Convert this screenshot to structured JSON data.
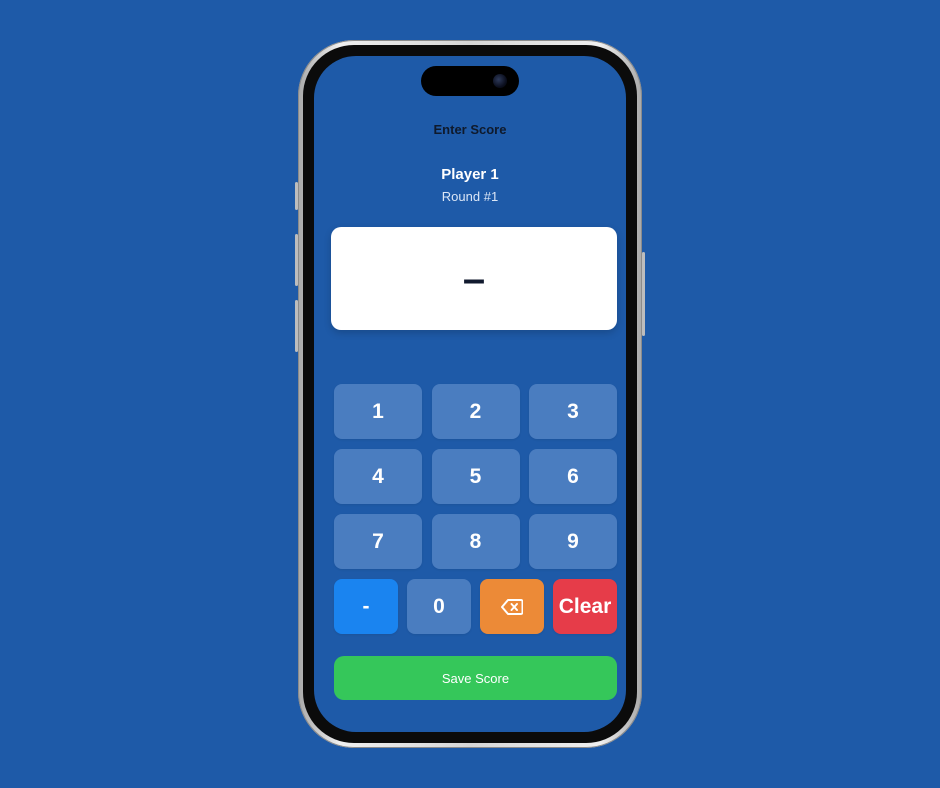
{
  "header": {
    "title": "Enter Score"
  },
  "player": {
    "name": "Player 1",
    "round": "Round #1"
  },
  "display": {
    "value": "–"
  },
  "keypad": {
    "rows": [
      [
        "1",
        "2",
        "3"
      ],
      [
        "4",
        "5",
        "6"
      ],
      [
        "7",
        "8",
        "9"
      ]
    ],
    "minus": "-",
    "zero": "0",
    "backspace_icon": "backspace-icon",
    "clear": "Clear"
  },
  "actions": {
    "save_label": "Save Score"
  },
  "colors": {
    "background": "#1e5aa8",
    "key": "#4a7dc0",
    "minus": "#1a84f0",
    "backspace": "#ec8a37",
    "clear": "#e63c49",
    "save": "#35c75a"
  }
}
